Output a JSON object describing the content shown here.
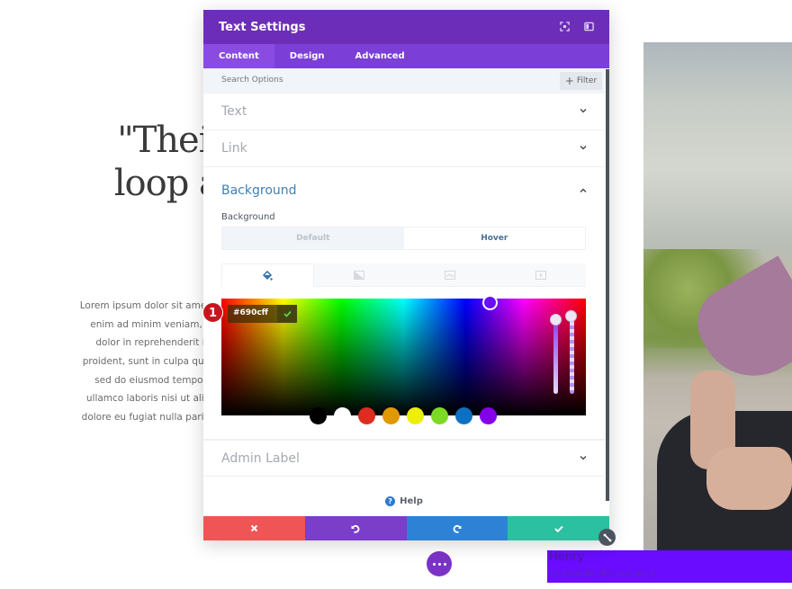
{
  "background_page": {
    "quote_lines": [
      "\"Their ab",
      "loop and"
    ],
    "lorem_lines": [
      "Lorem ipsum dolor sit amet, consectetur adipi",
      "enim ad minim veniam, quis nostrud exer",
      "dolor in reprehenderit in voluptate velit",
      "proident, sunt in culpa qui officia deserunt m",
      "sed do eiusmod tempor incididunt ut lal",
      "ullamco laboris nisi ut aliquip ex ea commo",
      "dolore eu fugiat nulla pariatur. Excepteur sint"
    ],
    "caption": {
      "name": "Henry",
      "role": "Co-Founder of Company X",
      "background_color": "#690cff"
    }
  },
  "modal": {
    "title": "Text Settings",
    "header_icons": [
      "fullscreen-icon",
      "sidebar-toggle-icon"
    ],
    "tabs": [
      {
        "label": "Content",
        "active": true
      },
      {
        "label": "Design",
        "active": false
      },
      {
        "label": "Advanced",
        "active": false
      }
    ],
    "search": {
      "placeholder": "Search Options",
      "value": ""
    },
    "filter_label": "Filter",
    "sections": {
      "text": {
        "title": "Text",
        "expanded": false
      },
      "link": {
        "title": "Link",
        "expanded": false
      },
      "background": {
        "title": "Background",
        "expanded": true,
        "field_label": "Background",
        "state_toggle": {
          "options": [
            "Default",
            "Hover"
          ],
          "selected": "Hover"
        },
        "type_tabs": [
          {
            "icon": "paint-bucket-icon",
            "active": true
          },
          {
            "icon": "gradient-icon",
            "active": false
          },
          {
            "icon": "image-icon",
            "active": false
          },
          {
            "icon": "video-icon",
            "active": false
          }
        ],
        "color_picker": {
          "hex_value": "#690cff",
          "step_badge": "1",
          "swatches": [
            "#000000",
            "#ffffff",
            "#e02b20",
            "#e09900",
            "#edf000",
            "#7cda24",
            "#0c71c3",
            "#8300e9"
          ]
        }
      },
      "admin_label": {
        "title": "Admin Label",
        "expanded": false
      }
    },
    "help_label": "Help",
    "actions": {
      "cancel": "cancel-icon",
      "undo": "undo-icon",
      "redo": "redo-icon",
      "save": "check-icon"
    },
    "colors": {
      "header": "#6c2eb9",
      "tabs": "#7b3ed6",
      "cancel": "#ef5555",
      "undo": "#7b3ec9",
      "redo": "#2e82d5",
      "save": "#2bc0a0"
    }
  }
}
